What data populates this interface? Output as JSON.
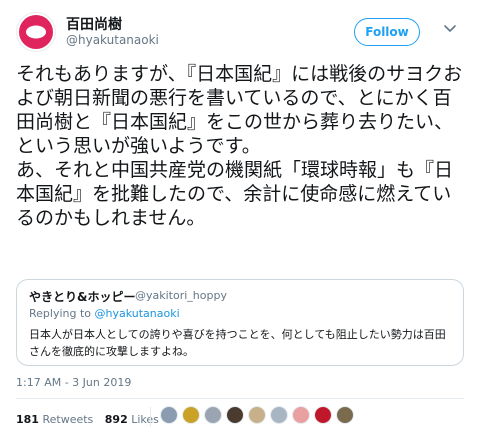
{
  "author": {
    "display_name": "百田尚樹",
    "handle": "@hyakutanaoki",
    "follow_label": "Follow"
  },
  "tweet_text": "それもありますが、『日本国紀』には戦後のサヨクおよび朝日新聞の悪行を書いているので、とにかく百田尚樹と『日本国紀』をこの世から葬り去りたい、という思いが強いようです。\nあ、それと中国共産党の機関紙「環球時報」も『日本国紀』を批難したので、余計に使命感に燃えているのかもしれません。",
  "quoted": {
    "name": "やきとり&ホッピー",
    "handle": "@yakitori_hoppy",
    "replying_prefix": "Replying to ",
    "replying_to": "@hyakutanaoki",
    "text": "日本人が日本人としての誇りや喜びを持つことを、何としても阻止したい勢力は百田さんを徹底的に攻撃しますよね。"
  },
  "timestamp": "1:17 AM - 3 Jun 2019",
  "stats": {
    "retweets_count": "181",
    "retweets_label": "Retweets",
    "likes_count": "892",
    "likes_label": "Likes"
  },
  "liker_colors": [
    "#8b9bb0",
    "#c9a227",
    "#9aa5b1",
    "#4a3b2e",
    "#c7b08a",
    "#a8b5c2",
    "#e8a0a0",
    "#c0182a",
    "#7a6a4e"
  ],
  "colors": {
    "accent": "#1da1f2",
    "avatar_ring": "#e0245e"
  }
}
